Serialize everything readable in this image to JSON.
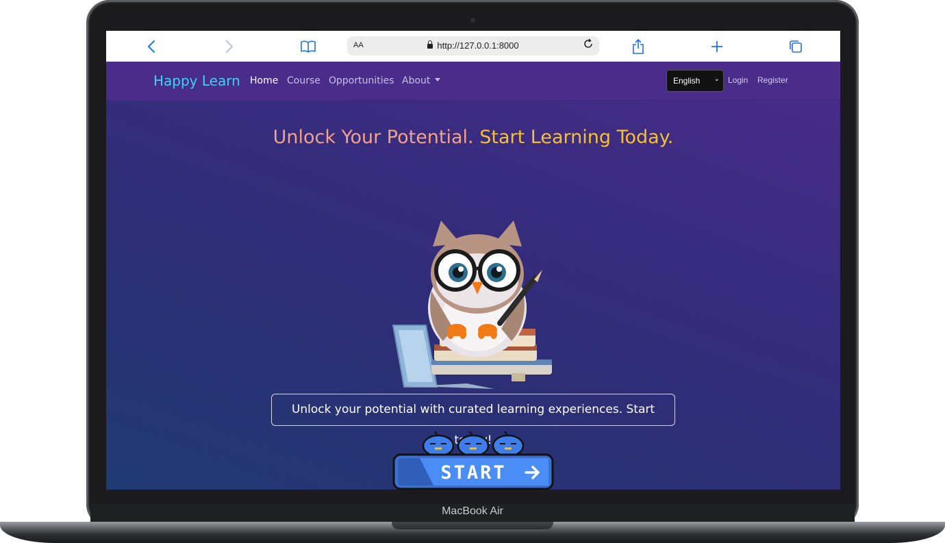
{
  "device": {
    "label": "MacBook Air"
  },
  "browser": {
    "text_size_label": "AA",
    "url": "http://127.0.0.1:8000"
  },
  "site": {
    "brand": "Happy Learn",
    "nav": {
      "home": "Home",
      "course": "Course",
      "opportunities": "Opportunities",
      "about": "About"
    },
    "language_select": {
      "selected": "English"
    },
    "login": "Login",
    "register": "Register"
  },
  "hero": {
    "headline_part1": "Unlock Your Potential.",
    "headline_part2": "Start Learning Today.",
    "tagline": "Unlock your potential with curated learning experiences. Start today!",
    "start_button": "START"
  },
  "colors": {
    "nav_bg": "#4a2d8b",
    "brand": "#3fd0f6",
    "headline_part1": "#f2a18a",
    "headline_part2": "#f6c02e",
    "browser_accent": "#1a73e8"
  }
}
